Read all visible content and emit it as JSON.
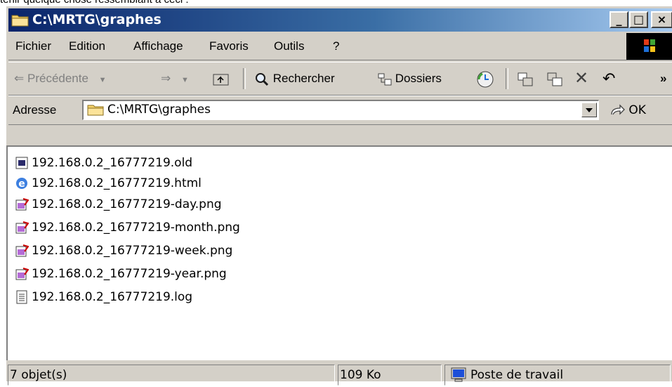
{
  "caption": "tenir quelque chose ressemblant à ceci :",
  "window": {
    "title": "C:\\MRTG\\graphes",
    "buttons": {
      "minimize": "_",
      "maximize": "□",
      "close": "×"
    }
  },
  "menu": [
    {
      "label": "Fichier"
    },
    {
      "label": "Edition"
    },
    {
      "label": "Affichage"
    },
    {
      "label": "Favoris"
    },
    {
      "label": "Outils"
    },
    {
      "label": "?"
    }
  ],
  "toolbar": {
    "back": "Précédente",
    "search": "Rechercher",
    "folders": "Dossiers",
    "more": "»"
  },
  "address": {
    "label": "Adresse",
    "value": "C:\\MRTG\\graphes",
    "go": "OK"
  },
  "files": [
    {
      "name": "192.168.0.2_16777219.old",
      "icon": "old-file-icon"
    },
    {
      "name": "192.168.0.2_16777219.html",
      "icon": "ie-html-icon"
    },
    {
      "name": "192.168.0.2_16777219-day.png",
      "icon": "png-image-icon"
    },
    {
      "name": "192.168.0.2_16777219-month.png",
      "icon": "png-image-icon"
    },
    {
      "name": "192.168.0.2_16777219-week.png",
      "icon": "png-image-icon"
    },
    {
      "name": "192.168.0.2_16777219-year.png",
      "icon": "png-image-icon"
    },
    {
      "name": "192.168.0.2_16777219.log",
      "icon": "text-file-icon"
    }
  ],
  "status": {
    "count": "7 objet(s)",
    "size": "109 Ko",
    "zone": "Poste de travail"
  }
}
